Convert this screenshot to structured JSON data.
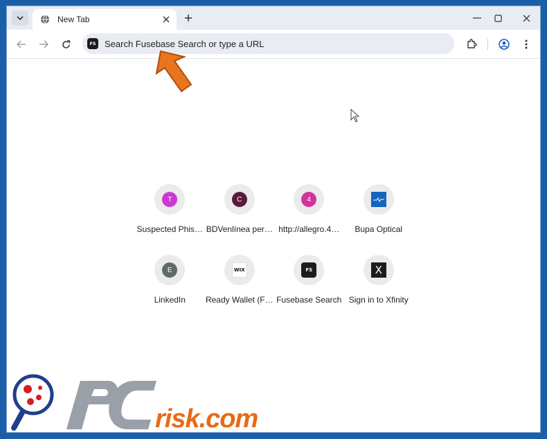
{
  "browser": {
    "tab": {
      "title": "New Tab"
    },
    "omnibox": {
      "placeholder": "Search Fusebase Search or type a URL",
      "badge": "FS"
    }
  },
  "colors": {
    "accent": "#e8761e",
    "shortcut_bg": "#ebebeb",
    "frame_bg": "#1b5fa8"
  },
  "icons": [
    "tab-search-icon",
    "globe-icon",
    "close-icon",
    "plus-icon",
    "minimize-icon",
    "maximize-icon",
    "back-icon",
    "forward-icon",
    "reload-icon",
    "extensions-icon",
    "profile-icon",
    "menu-icon"
  ],
  "shortcuts": [
    {
      "label": "Suspected Phis…",
      "letter": "T",
      "color": "#c93ad0"
    },
    {
      "label": "BDVenlínea per…",
      "letter": "C",
      "color": "#5a1a3c"
    },
    {
      "label": "http://allegro.4…",
      "letter": "4",
      "color": "#d1359c"
    },
    {
      "label": "Bupa Optical",
      "letter": "",
      "color": "#1565c0"
    },
    {
      "label": "LinkedIn",
      "letter": "E",
      "color": "#5f6b6b"
    },
    {
      "label": "Ready Wallet (F…",
      "letter": "WIX",
      "color": "#ffffff"
    },
    {
      "label": "Fusebase Search",
      "letter": "FS",
      "color": "#1c1c1c"
    },
    {
      "label": "Sign in to Xfinity",
      "letter": "X",
      "color": "#1c1c1c"
    }
  ],
  "watermark": {
    "text": "risk.com"
  }
}
